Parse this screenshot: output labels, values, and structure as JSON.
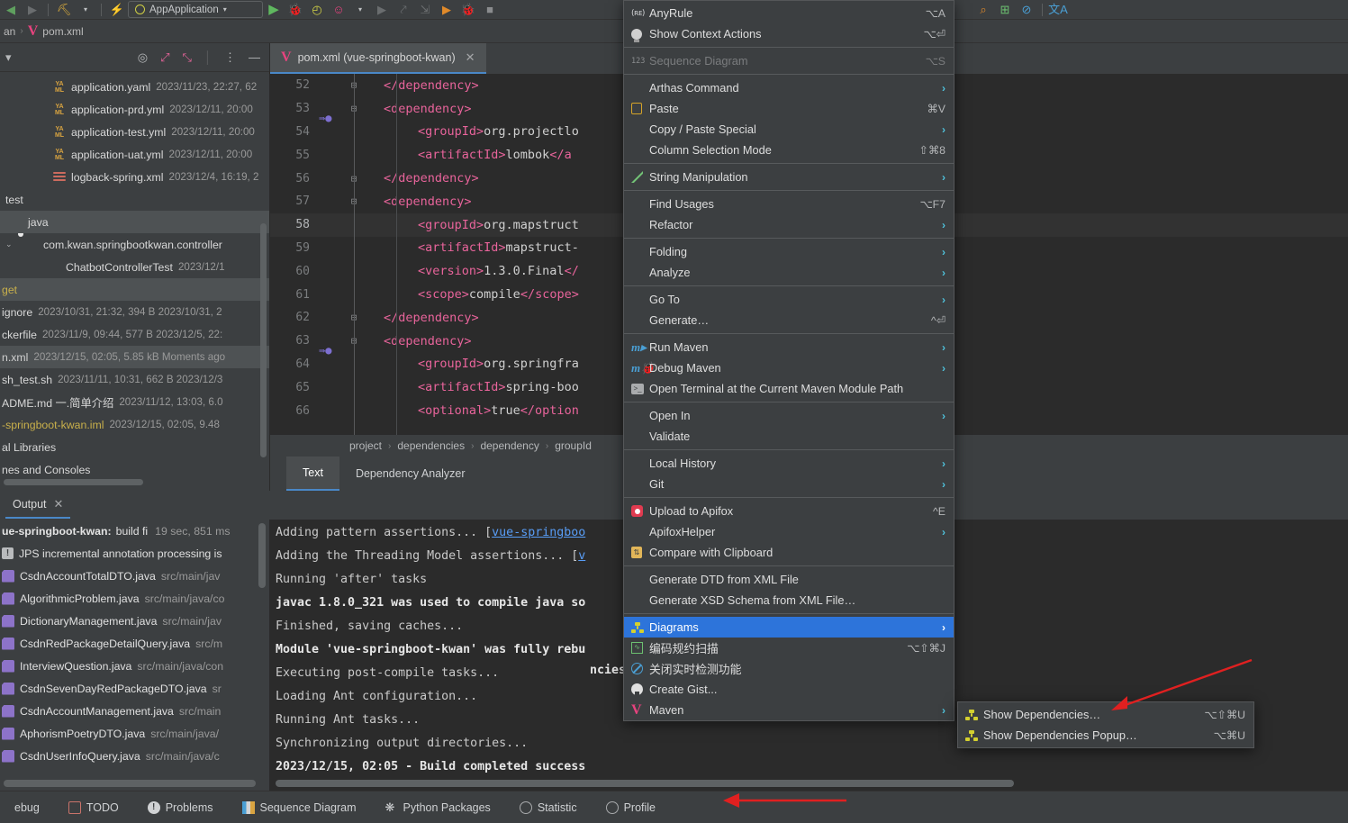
{
  "toolbar": {
    "run_config": "AppApplication",
    "icons": [
      "back-icon",
      "forward-icon",
      "build-hammer-icon",
      "dropdown-caret",
      "lightning-icon",
      "run-icon",
      "debug-icon",
      "coverage-icon",
      "profile-icon",
      "caret-icon",
      "run-disabled-icon",
      "step-icon",
      "step-debug-icon",
      "run-green-icon",
      "debug-green-icon",
      "stop-icon",
      "search-everywhere-icon",
      "scan-icon",
      "no-icon",
      "translate-icon"
    ],
    "translate_label": "A"
  },
  "navbar": {
    "parts": [
      "an",
      "pom.xml"
    ]
  },
  "project": {
    "header_icons": [
      "locate-icon",
      "expand-all-icon",
      "collapse-all-icon",
      "more-icon",
      "hide-icon"
    ],
    "items": [
      {
        "icon": "yaml-icon",
        "name": "application.yaml",
        "meta": "2023/11/23, 22:27, 62",
        "indent": 1
      },
      {
        "icon": "yaml-icon",
        "name": "application-prd.yml",
        "meta": "2023/12/11, 20:00",
        "indent": 1
      },
      {
        "icon": "yaml-icon",
        "name": "application-test.yml",
        "meta": "2023/12/11, 20:00",
        "indent": 1
      },
      {
        "icon": "yaml-icon",
        "name": "application-uat.yml",
        "meta": "2023/12/11, 20:00",
        "indent": 1
      },
      {
        "icon": "xml-icon",
        "name": "logback-spring.xml",
        "meta": "2023/12/4, 16:19, 2",
        "indent": 1
      },
      {
        "icon": "none",
        "name": "test",
        "meta": "",
        "indent": 0
      },
      {
        "icon": "folder-icon",
        "name": "java",
        "meta": "",
        "indent": 0,
        "selected": true
      },
      {
        "icon": "package-icon",
        "name": "com.kwan.springbootkwan.controller",
        "meta": "",
        "indent": 1,
        "expanded": true
      },
      {
        "icon": "class-icon",
        "name": "ChatbotControllerTest",
        "meta": "2023/12/1",
        "indent": 2
      },
      {
        "icon": "none",
        "name": "get",
        "meta": "",
        "indent": 0,
        "yellow": true,
        "selected": true
      },
      {
        "icon": "none",
        "name": "ignore",
        "meta": "2023/10/31, 21:32, 394 B 2023/10/31, 2",
        "indent": 0
      },
      {
        "icon": "none",
        "name": "ckerfile",
        "meta": "2023/11/9, 09:44, 577 B 2023/12/5, 22:",
        "indent": 0
      },
      {
        "icon": "none",
        "name": "n.xml",
        "meta": "2023/12/15, 02:05, 5.85 kB Moments ago",
        "indent": 0,
        "selected": true
      },
      {
        "icon": "none",
        "name": "sh_test.sh",
        "meta": "2023/11/11, 10:31, 662 B 2023/12/3",
        "indent": 0
      },
      {
        "icon": "none",
        "name": "ADME.md 一.简单介绍",
        "meta": "2023/11/12, 13:03, 6.0",
        "indent": 0
      },
      {
        "icon": "none",
        "name": "-springboot-kwan.iml",
        "meta": "2023/12/15, 02:05, 9.48",
        "indent": 0,
        "yellow": true
      },
      {
        "icon": "none",
        "name": "al Libraries",
        "meta": "",
        "indent": 0
      },
      {
        "icon": "none",
        "name": "nes and Consoles",
        "meta": "",
        "indent": 0
      }
    ]
  },
  "editor": {
    "tab_label": "pom.xml (vue-springboot-kwan)",
    "lines": [
      {
        "n": "52",
        "fold": "-",
        "indent": 1,
        "parts": [
          [
            "tg",
            "</dependency>"
          ]
        ]
      },
      {
        "n": "53",
        "fold": "+",
        "bean": true,
        "indent": 1,
        "parts": [
          [
            "tg",
            "<dependency>"
          ]
        ]
      },
      {
        "n": "54",
        "fold": "",
        "indent": 2,
        "parts": [
          [
            "tg",
            "<groupId>"
          ],
          [
            "tx",
            "org.projectlo"
          ]
        ]
      },
      {
        "n": "55",
        "fold": "",
        "indent": 2,
        "parts": [
          [
            "tg",
            "<artifactId>"
          ],
          [
            "tx",
            "lombok"
          ],
          [
            "tg",
            "</a"
          ]
        ]
      },
      {
        "n": "56",
        "fold": "-",
        "indent": 1,
        "parts": [
          [
            "tg",
            "</dependency>"
          ]
        ]
      },
      {
        "n": "57",
        "fold": "+",
        "indent": 1,
        "parts": [
          [
            "tg",
            "<dependency>"
          ]
        ]
      },
      {
        "n": "58",
        "fold": "",
        "indent": 2,
        "current": true,
        "parts": [
          [
            "tg",
            "<groupId>"
          ],
          [
            "tx",
            "org.mapstruct"
          ]
        ]
      },
      {
        "n": "59",
        "fold": "",
        "indent": 2,
        "parts": [
          [
            "tg",
            "<artifactId>"
          ],
          [
            "tx",
            "mapstruct-"
          ]
        ]
      },
      {
        "n": "60",
        "fold": "",
        "indent": 2,
        "parts": [
          [
            "tg",
            "<version>"
          ],
          [
            "tx",
            "1.3.0.Final"
          ],
          [
            "tg",
            "</"
          ]
        ]
      },
      {
        "n": "61",
        "fold": "",
        "indent": 2,
        "parts": [
          [
            "tg",
            "<scope>"
          ],
          [
            "tx",
            "compile"
          ],
          [
            "tg",
            "</scope>"
          ]
        ]
      },
      {
        "n": "62",
        "fold": "-",
        "indent": 1,
        "parts": [
          [
            "tg",
            "</dependency>"
          ]
        ]
      },
      {
        "n": "63",
        "fold": "+",
        "bean": true,
        "indent": 1,
        "parts": [
          [
            "tg",
            "<dependency>"
          ]
        ]
      },
      {
        "n": "64",
        "fold": "",
        "indent": 2,
        "parts": [
          [
            "tg",
            "<groupId>"
          ],
          [
            "tx",
            "org.springfra"
          ]
        ]
      },
      {
        "n": "65",
        "fold": "",
        "indent": 2,
        "parts": [
          [
            "tg",
            "<artifactId>"
          ],
          [
            "tx",
            "spring-boo"
          ]
        ]
      },
      {
        "n": "66",
        "fold": "",
        "indent": 2,
        "parts": [
          [
            "tg",
            "<optional>"
          ],
          [
            "tx",
            "true"
          ],
          [
            "tg",
            "</option"
          ]
        ]
      }
    ],
    "breadcrumbs": [
      "project",
      "dependencies",
      "dependency",
      "groupId"
    ],
    "bottom_tabs": [
      {
        "label": "Text",
        "active": true
      },
      {
        "label": "Dependency Analyzer",
        "active": false
      }
    ]
  },
  "build": {
    "tab_label": "Output",
    "summary": {
      "title": "ue-springboot-kwan:",
      "status": "build fi",
      "time": "19 sec, 851 ms"
    },
    "tree": [
      {
        "icon": "warn-icon",
        "name": "JPS incremental annotation processing is",
        "path": ""
      },
      {
        "icon": "java-icon",
        "name": "CsdnAccountTotalDTO.java",
        "path": "src/main/jav"
      },
      {
        "icon": "java-icon",
        "name": "AlgorithmicProblem.java",
        "path": "src/main/java/co"
      },
      {
        "icon": "java-icon",
        "name": "DictionaryManagement.java",
        "path": "src/main/jav"
      },
      {
        "icon": "java-icon",
        "name": "CsdnRedPackageDetailQuery.java",
        "path": "src/m"
      },
      {
        "icon": "java-icon",
        "name": "InterviewQuestion.java",
        "path": "src/main/java/con"
      },
      {
        "icon": "java-icon",
        "name": "CsdnSevenDayRedPackageDTO.java",
        "path": "sr"
      },
      {
        "icon": "java-icon",
        "name": "CsdnAccountManagement.java",
        "path": "src/main"
      },
      {
        "icon": "java-icon",
        "name": "AphorismPoetryDTO.java",
        "path": "src/main/java/"
      },
      {
        "icon": "java-icon",
        "name": "CsdnUserInfoQuery.java",
        "path": "src/main/java/c"
      }
    ],
    "console": [
      {
        "bold": false,
        "text": "Adding pattern assertions... [",
        "link": "vue-springboo"
      },
      {
        "bold": false,
        "text": "Adding the Threading Model assertions... [",
        "link": "v"
      },
      {
        "bold": false,
        "text": "Running 'after' tasks",
        "link": ""
      },
      {
        "bold": true,
        "text": "javac 1.8.0_321 was used to compile java so",
        "link": ""
      },
      {
        "bold": false,
        "text": "Finished, saving caches...",
        "link": ""
      },
      {
        "bold": true,
        "text": "Module 'vue-springboot-kwan' was fully rebu",
        "link": ""
      },
      {
        "bold": false,
        "text": "Executing post-compile tasks...",
        "link": ""
      },
      {
        "bold": false,
        "text": "Loading Ant configuration...",
        "link": ""
      },
      {
        "bold": false,
        "text": "Running Ant tasks...",
        "link": ""
      },
      {
        "bold": false,
        "text": "Synchronizing output directories...",
        "link": ""
      },
      {
        "bold": true,
        "text": "2023/12/15, 02:05 - Build completed success",
        "link": ""
      }
    ],
    "far_right_text": "ncies changes"
  },
  "statusbar": {
    "items": [
      {
        "icon": "none",
        "label": "ebug"
      },
      {
        "icon": "todo-icon",
        "label": "TODO"
      },
      {
        "icon": "problems-icon",
        "label": "Problems"
      },
      {
        "icon": "sequence-icon",
        "label": "Sequence Diagram"
      },
      {
        "icon": "python-icon",
        "label": "Python Packages"
      },
      {
        "icon": "statistic-icon",
        "label": "Statistic"
      },
      {
        "icon": "profile-icon",
        "label": "Profile"
      }
    ]
  },
  "context_menu": {
    "items": [
      {
        "type": "item",
        "icon": "anyrule-icon",
        "label": "AnyRule",
        "accel": "⌥A",
        "sub": false
      },
      {
        "type": "item",
        "icon": "bulb-icon",
        "label": "Show Context Actions",
        "accel": "⌥⏎",
        "sub": false
      },
      {
        "type": "sep"
      },
      {
        "type": "item",
        "icon": "numbers-icon",
        "label": "Sequence Diagram",
        "accel": "⌥S",
        "sub": false,
        "disabled": true
      },
      {
        "type": "sep"
      },
      {
        "type": "item",
        "icon": "none",
        "label": "Arthas Command",
        "accel": "",
        "sub": true
      },
      {
        "type": "item",
        "icon": "clipboard-icon",
        "label": "Paste",
        "accel": "⌘V",
        "sub": false
      },
      {
        "type": "item",
        "icon": "none",
        "label": "Copy / Paste Special",
        "accel": "",
        "sub": true
      },
      {
        "type": "item",
        "icon": "none",
        "label": "Column Selection Mode",
        "accel": "⇧⌘8",
        "sub": false
      },
      {
        "type": "sep"
      },
      {
        "type": "item",
        "icon": "pencil-icon",
        "label": "String Manipulation",
        "accel": "",
        "sub": true
      },
      {
        "type": "sep"
      },
      {
        "type": "item",
        "icon": "none",
        "label": "Find Usages",
        "accel": "⌥F7",
        "sub": false
      },
      {
        "type": "item",
        "icon": "none",
        "label": "Refactor",
        "accel": "",
        "sub": true
      },
      {
        "type": "sep"
      },
      {
        "type": "item",
        "icon": "none",
        "label": "Folding",
        "accel": "",
        "sub": true
      },
      {
        "type": "item",
        "icon": "none",
        "label": "Analyze",
        "accel": "",
        "sub": true
      },
      {
        "type": "sep"
      },
      {
        "type": "item",
        "icon": "none",
        "label": "Go To",
        "accel": "",
        "sub": true
      },
      {
        "type": "item",
        "icon": "none",
        "label": "Generate…",
        "accel": "^⏎",
        "sub": false
      },
      {
        "type": "sep"
      },
      {
        "type": "item",
        "icon": "maven-run-icon",
        "label": "Run Maven",
        "accel": "",
        "sub": true
      },
      {
        "type": "item",
        "icon": "maven-debug-icon",
        "label": "Debug Maven",
        "accel": "",
        "sub": true
      },
      {
        "type": "item",
        "icon": "terminal-icon",
        "label": "Open Terminal at the Current Maven Module Path",
        "accel": "",
        "sub": false
      },
      {
        "type": "sep"
      },
      {
        "type": "item",
        "icon": "none",
        "label": "Open In",
        "accel": "",
        "sub": true
      },
      {
        "type": "item",
        "icon": "none",
        "label": "Validate",
        "accel": "",
        "sub": false
      },
      {
        "type": "sep"
      },
      {
        "type": "item",
        "icon": "none",
        "label": "Local History",
        "accel": "",
        "sub": true
      },
      {
        "type": "item",
        "icon": "none",
        "label": "Git",
        "accel": "",
        "sub": true
      },
      {
        "type": "sep"
      },
      {
        "type": "item",
        "icon": "apifox-icon",
        "label": "Upload to Apifox",
        "accel": "^E",
        "sub": false
      },
      {
        "type": "item",
        "icon": "none",
        "label": "ApifoxHelper",
        "accel": "",
        "sub": true
      },
      {
        "type": "item",
        "icon": "compare-icon",
        "label": "Compare with Clipboard",
        "accel": "",
        "sub": false
      },
      {
        "type": "sep"
      },
      {
        "type": "item",
        "icon": "none",
        "label": "Generate DTD from XML File",
        "accel": "",
        "sub": false
      },
      {
        "type": "item",
        "icon": "none",
        "label": "Generate XSD Schema from XML File…",
        "accel": "",
        "sub": false
      },
      {
        "type": "sep"
      },
      {
        "type": "item",
        "icon": "diagram-icon",
        "label": "Diagrams",
        "accel": "",
        "sub": true,
        "highlighted": true
      },
      {
        "type": "item",
        "icon": "scan-icon",
        "label": "编码规约扫描",
        "accel": "⌥⇧⌘J",
        "sub": false
      },
      {
        "type": "item",
        "icon": "ban-icon",
        "label": "关闭实时检测功能",
        "accel": "",
        "sub": false
      },
      {
        "type": "item",
        "icon": "github-icon",
        "label": "Create Gist...",
        "accel": "",
        "sub": false
      },
      {
        "type": "item",
        "icon": "maven-icon",
        "label": "Maven",
        "accel": "",
        "sub": true
      }
    ]
  },
  "submenu": {
    "items": [
      {
        "icon": "diagram-icon",
        "label": "Show Dependencies…",
        "accel": "⌥⇧⌘U"
      },
      {
        "icon": "diagram-icon",
        "label": "Show Dependencies Popup…",
        "accel": "⌥⌘U"
      }
    ]
  },
  "colors": {
    "highlight": "#2d74da",
    "accent_blue": "#4a88c7",
    "annotation_red": "#e02020",
    "panel_bg": "#3c3f41",
    "editor_bg": "#2b2b2b"
  }
}
